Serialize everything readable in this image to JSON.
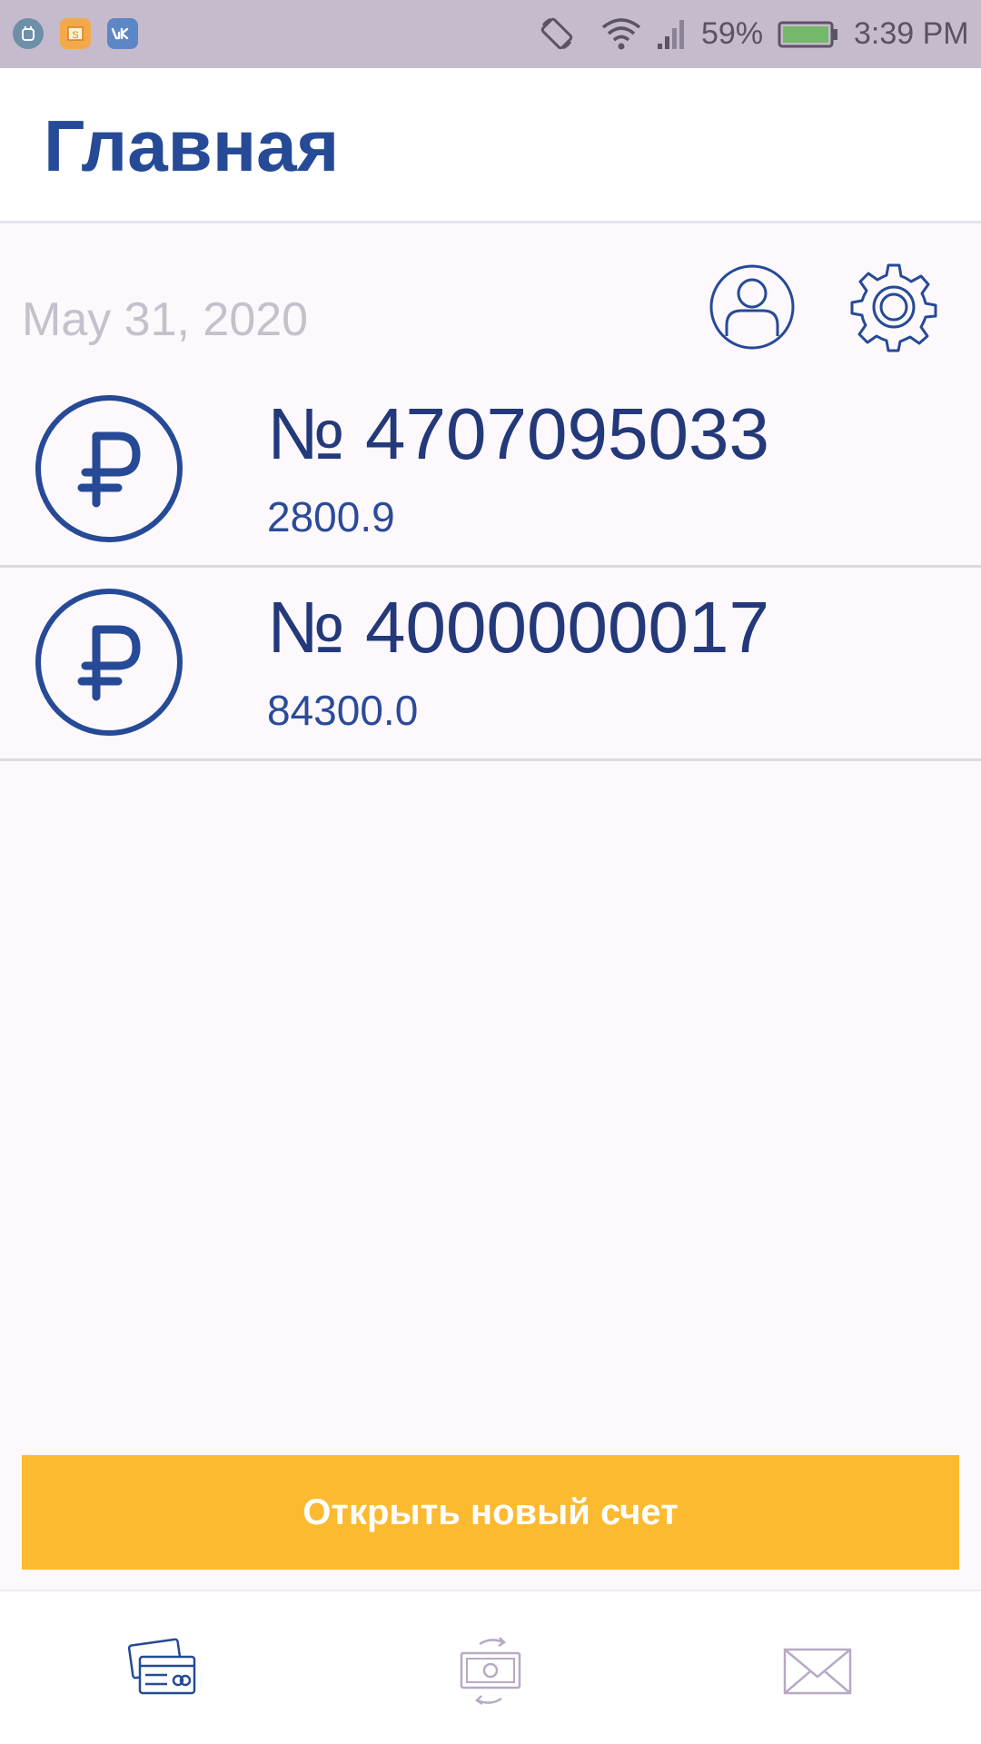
{
  "status_bar": {
    "battery_percent": "59%",
    "time": "3:39 PM",
    "notification_icons": [
      "android-debug-icon",
      "photo-app-icon",
      "vk-icon"
    ],
    "system_icons": [
      "screen-rotation-icon",
      "wifi-icon",
      "cellular-signal-icon",
      "battery-icon"
    ],
    "battery_level": 0.59
  },
  "header": {
    "title": "Главная"
  },
  "date_row": {
    "date": "May 31, 2020",
    "profile_icon": "profile-icon",
    "settings_icon": "gear-icon"
  },
  "accounts": [
    {
      "number": "№ 4707095033",
      "balance": "2800.9",
      "currency_icon": "ruble-icon"
    },
    {
      "number": "№ 4000000017",
      "balance": "84300.0",
      "currency_icon": "ruble-icon"
    }
  ],
  "actions": {
    "open_account_label": "Открыть новый счет"
  },
  "bottom_nav": {
    "items": [
      {
        "icon": "cards-icon",
        "active": true
      },
      {
        "icon": "money-transfer-icon",
        "active": false
      },
      {
        "icon": "envelope-icon",
        "active": false
      }
    ]
  },
  "colors": {
    "primary": "#264a96",
    "accent": "#fcba30",
    "status_bar": "#c6bacd",
    "inactive_icon": "#b8a9c6"
  }
}
